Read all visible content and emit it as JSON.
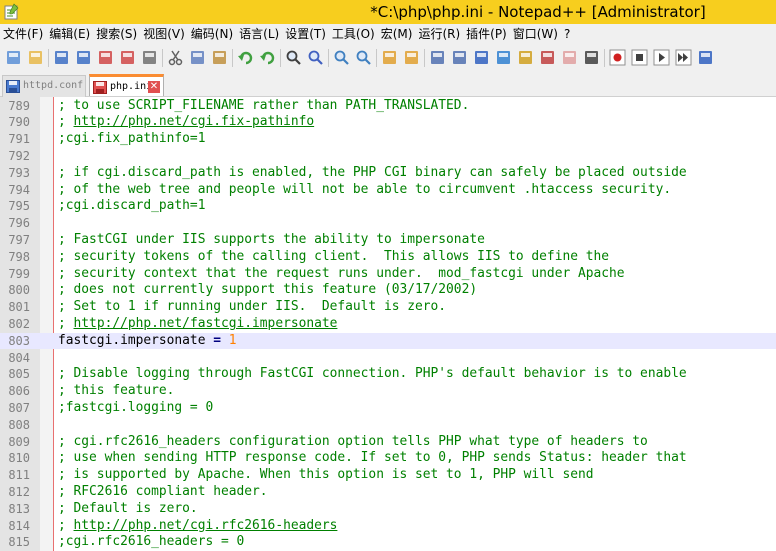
{
  "window": {
    "title": "*C:\\php\\php.ini - Notepad++ [Administrator]"
  },
  "menu": [
    "文件(F)",
    "编辑(E)",
    "搜索(S)",
    "视图(V)",
    "编码(N)",
    "语言(L)",
    "设置(T)",
    "工具(O)",
    "宏(M)",
    "运行(R)",
    "插件(P)",
    "窗口(W)",
    "?"
  ],
  "toolbar": [
    {
      "icon": "new-file-icon",
      "color": "#5a8fd6"
    },
    {
      "icon": "open-file-icon",
      "color": "#e8b84a"
    },
    {
      "icon": "save-icon",
      "color": "#3c6fc4"
    },
    {
      "icon": "save-all-icon",
      "color": "#3c6fc4"
    },
    {
      "icon": "close-icon",
      "color": "#d04848"
    },
    {
      "icon": "close-all-icon",
      "color": "#d04848"
    },
    {
      "icon": "print-icon",
      "color": "#707070"
    },
    {
      "icon": "cut-icon",
      "color": "#606060"
    },
    {
      "icon": "copy-icon",
      "color": "#6080c0"
    },
    {
      "icon": "paste-icon",
      "color": "#c09040"
    },
    {
      "icon": "undo-icon",
      "color": "#40a040"
    },
    {
      "icon": "redo-icon",
      "color": "#40a040"
    },
    {
      "icon": "find-icon",
      "color": "#404040"
    },
    {
      "icon": "replace-icon",
      "color": "#4060c0"
    },
    {
      "icon": "zoom-in-icon",
      "color": "#4080c0"
    },
    {
      "icon": "zoom-out-icon",
      "color": "#4080c0"
    },
    {
      "icon": "sync-vertical-icon",
      "color": "#e0a030"
    },
    {
      "icon": "sync-horizontal-icon",
      "color": "#e0a030"
    },
    {
      "icon": "word-wrap-icon",
      "color": "#5070b0"
    },
    {
      "icon": "show-all-chars-icon",
      "color": "#5070b0"
    },
    {
      "icon": "indent-guide-icon",
      "color": "#3060c0"
    },
    {
      "icon": "doc-map-icon",
      "color": "#3080d0"
    },
    {
      "icon": "user-lang-icon",
      "color": "#d0a020"
    },
    {
      "icon": "function-list-icon",
      "color": "#c04040"
    },
    {
      "icon": "folder-workspace-icon",
      "color": "#e0a0a0"
    },
    {
      "icon": "monitor-icon",
      "color": "#404040"
    },
    {
      "icon": "record-macro-icon",
      "color": "#d02020"
    },
    {
      "icon": "stop-record-icon",
      "color": "#404040"
    },
    {
      "icon": "play-macro-icon",
      "color": "#404040"
    },
    {
      "icon": "play-multiple-icon",
      "color": "#404040"
    },
    {
      "icon": "save-macro-icon",
      "color": "#3060c0"
    }
  ],
  "tabs": [
    {
      "label": "httpd.conf",
      "active": false
    },
    {
      "label": "php.ini",
      "active": true
    }
  ],
  "editor": {
    "lines": [
      {
        "num": "789",
        "text": "; to use SCRIPT_FILENAME rather than PATH_TRANSLATED.",
        "kind": "comment"
      },
      {
        "num": "790",
        "prefix": "; ",
        "url": "http://php.net/cgi.fix-pathinfo",
        "kind": "comment-url"
      },
      {
        "num": "791",
        "text": ";cgi.fix_pathinfo=1",
        "kind": "comment"
      },
      {
        "num": "792",
        "text": "",
        "kind": "comment"
      },
      {
        "num": "793",
        "text": "; if cgi.discard_path is enabled, the PHP CGI binary can safely be placed outside",
        "kind": "comment"
      },
      {
        "num": "794",
        "text": "; of the web tree and people will not be able to circumvent .htaccess security.",
        "kind": "comment"
      },
      {
        "num": "795",
        "text": ";cgi.discard_path=1",
        "kind": "comment"
      },
      {
        "num": "796",
        "text": "",
        "kind": "comment"
      },
      {
        "num": "797",
        "text": "; FastCGI under IIS supports the ability to impersonate",
        "kind": "comment"
      },
      {
        "num": "798",
        "text": "; security tokens of the calling client.  This allows IIS to define the",
        "kind": "comment"
      },
      {
        "num": "799",
        "text": "; security context that the request runs under.  mod_fastcgi under Apache",
        "kind": "comment"
      },
      {
        "num": "800",
        "text": "; does not currently support this feature (03/17/2002)",
        "kind": "comment"
      },
      {
        "num": "801",
        "text": "; Set to 1 if running under IIS.  Default is zero.",
        "kind": "comment"
      },
      {
        "num": "802",
        "prefix": "; ",
        "url": "http://php.net/fastcgi.impersonate",
        "kind": "comment-url"
      },
      {
        "num": "803",
        "key": "fastcgi.impersonate",
        "op": " = ",
        "value": "1",
        "kind": "setting",
        "current": true
      },
      {
        "num": "804",
        "text": "",
        "kind": "comment"
      },
      {
        "num": "805",
        "text": "; Disable logging through FastCGI connection. PHP's default behavior is to enable",
        "kind": "comment"
      },
      {
        "num": "806",
        "text": "; this feature.",
        "kind": "comment"
      },
      {
        "num": "807",
        "text": ";fastcgi.logging = 0",
        "kind": "comment"
      },
      {
        "num": "808",
        "text": "",
        "kind": "comment"
      },
      {
        "num": "809",
        "text": "; cgi.rfc2616_headers configuration option tells PHP what type of headers to",
        "kind": "comment"
      },
      {
        "num": "810",
        "text": "; use when sending HTTP response code. If set to 0, PHP sends Status: header that",
        "kind": "comment"
      },
      {
        "num": "811",
        "text": "; is supported by Apache. When this option is set to 1, PHP will send",
        "kind": "comment"
      },
      {
        "num": "812",
        "text": "; RFC2616 compliant header.",
        "kind": "comment"
      },
      {
        "num": "813",
        "text": "; Default is zero.",
        "kind": "comment"
      },
      {
        "num": "814",
        "prefix": "; ",
        "url": "http://php.net/cgi.rfc2616-headers",
        "kind": "comment-url"
      },
      {
        "num": "815",
        "text": ";cgi.rfc2616_headers = 0",
        "kind": "comment"
      }
    ]
  }
}
